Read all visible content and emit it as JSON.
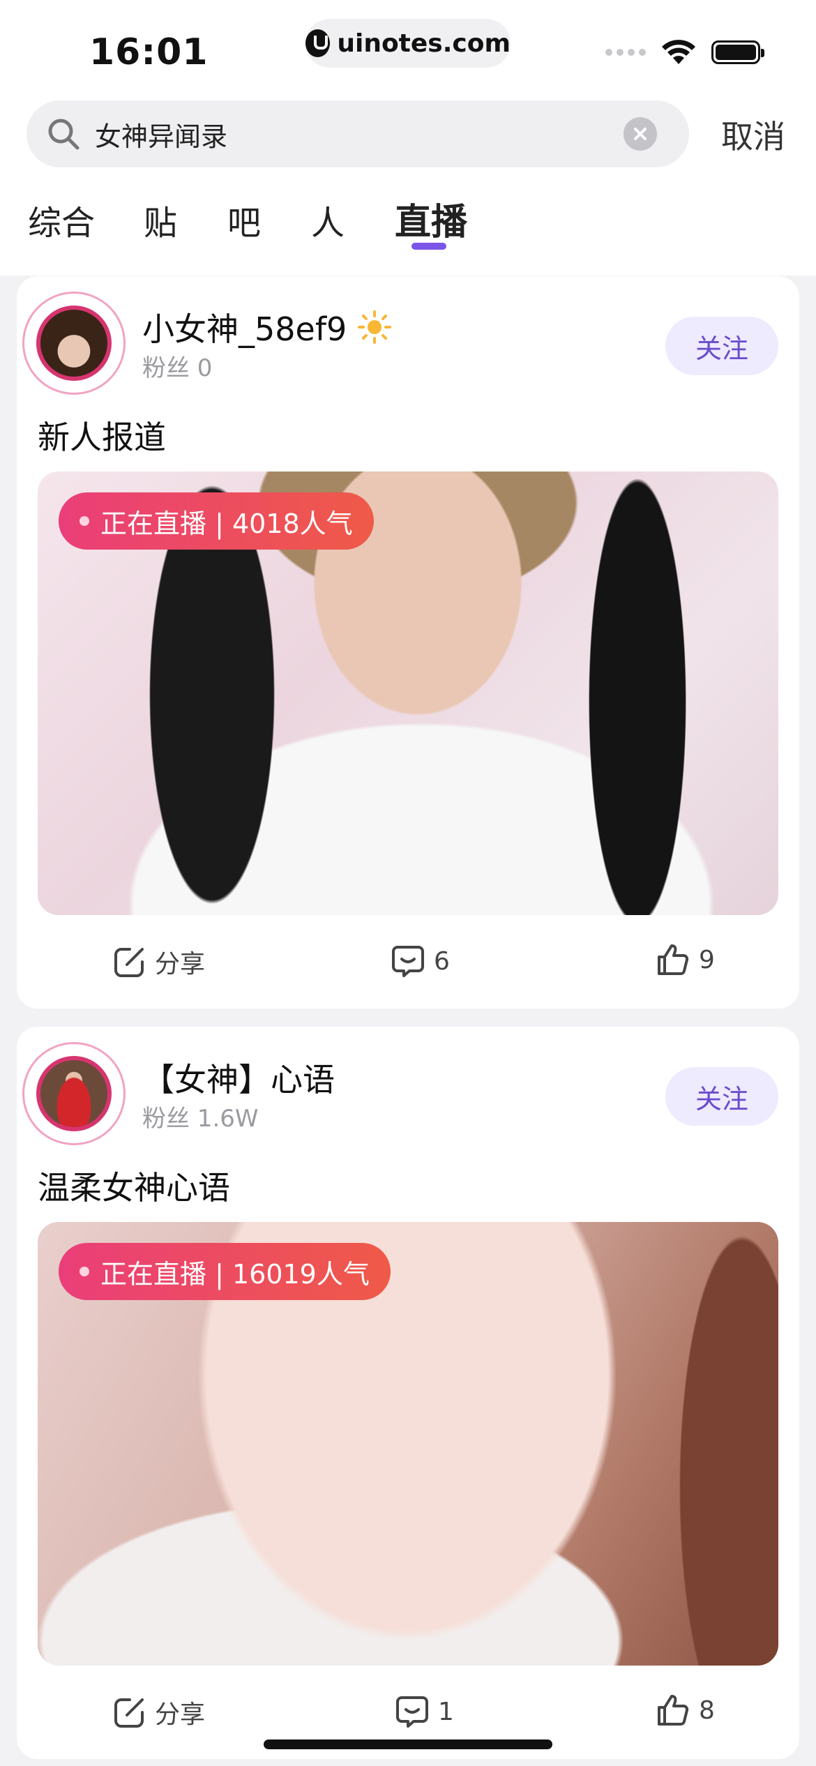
{
  "status_bar": {
    "time": "16:01",
    "url": "uinotes.com"
  },
  "search": {
    "query": "女神异闻录",
    "cancel_label": "取消"
  },
  "tabs": [
    {
      "label": "综合",
      "active": false
    },
    {
      "label": "贴",
      "active": false
    },
    {
      "label": "吧",
      "active": false
    },
    {
      "label": "人",
      "active": false
    },
    {
      "label": "直播",
      "active": true
    }
  ],
  "posts": [
    {
      "author": "小女神_58ef9",
      "author_badge_icon": "sun-icon",
      "fans": "粉丝 0",
      "follow_label": "关注",
      "title": "新人报道",
      "live_badge": "正在直播 | 4018人气",
      "share_label": "分享",
      "comments": "6",
      "likes": "9"
    },
    {
      "author": "【女神】心语",
      "fans": "粉丝 1.6W",
      "follow_label": "关注",
      "title": "温柔女神心语",
      "live_badge": "正在直播 | 16019人气",
      "share_label": "分享",
      "comments": "1",
      "likes": "8"
    }
  ],
  "colors": {
    "accent": "#7b54e8",
    "live_badge_start": "#ea3e79",
    "live_badge_end": "#ef5a48",
    "follow_bg": "#eeeaff",
    "follow_text": "#6a4ccc"
  }
}
